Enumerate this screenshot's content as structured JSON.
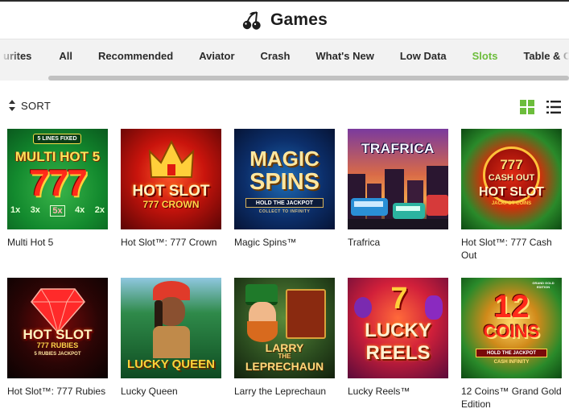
{
  "header": {
    "title": "Games",
    "icon": "cherries-icon"
  },
  "tabs": [
    {
      "label": "urites",
      "active": false
    },
    {
      "label": "All",
      "active": false
    },
    {
      "label": "Recommended",
      "active": false
    },
    {
      "label": "Aviator",
      "active": false
    },
    {
      "label": "Crash",
      "active": false
    },
    {
      "label": "What's New",
      "active": false
    },
    {
      "label": "Low Data",
      "active": false
    },
    {
      "label": "Slots",
      "active": true
    },
    {
      "label": "Table & Card",
      "active": false
    }
  ],
  "toolbar": {
    "sort_label": "SORT",
    "view_mode": "grid"
  },
  "colors": {
    "accent": "#6cbd3b",
    "text": "#222222"
  },
  "games": [
    {
      "name": "Multi Hot 5",
      "art": {
        "top": "5 LINES FIXED",
        "title": "MULTI HOT 5",
        "sub": "777",
        "extra": [
          "1x",
          "3x",
          "5x",
          "4x",
          "2x"
        ]
      }
    },
    {
      "name": "Hot Slot™: 777 Crown",
      "art": {
        "title": "HOT SLOT",
        "sub": "777 CROWN"
      }
    },
    {
      "name": "Magic Spins™",
      "art": {
        "title": "MAGIC",
        "title2": "SPINS",
        "sub": "HOLD THE JACKPOT",
        "sub2": "COLLECT TO INFINITY"
      }
    },
    {
      "name": "Trafrica",
      "art": {
        "title": "TRAFRICA"
      }
    },
    {
      "name": "Hot Slot™: 777 Cash Out",
      "art": {
        "top": "777",
        "title": "CASH OUT",
        "title2": "HOT SLOT",
        "sub": "JACKPOT COINS"
      }
    },
    {
      "name": "Hot Slot™: 777 Rubies",
      "art": {
        "title": "HOT SLOT",
        "sub": "777 RUBIES",
        "sub2": "5 RUBIES JACKPOT"
      }
    },
    {
      "name": "Lucky Queen",
      "art": {
        "title": "LUCKY QUEEN"
      }
    },
    {
      "name": "Larry the Leprechaun",
      "art": {
        "title": "LARRY",
        "title2": "THE",
        "sub": "LEPRECHAUN"
      }
    },
    {
      "name": "Lucky Reels™",
      "art": {
        "title": "LUCKY",
        "title2": "REELS"
      }
    },
    {
      "name": "12 Coins™ Grand Gold Edition",
      "art": {
        "top": "GRAND GOLD EDITION",
        "title": "12",
        "title2": "COINS",
        "sub": "HOLD THE JACKPOT",
        "sub2": "CASH INFINITY"
      }
    }
  ]
}
